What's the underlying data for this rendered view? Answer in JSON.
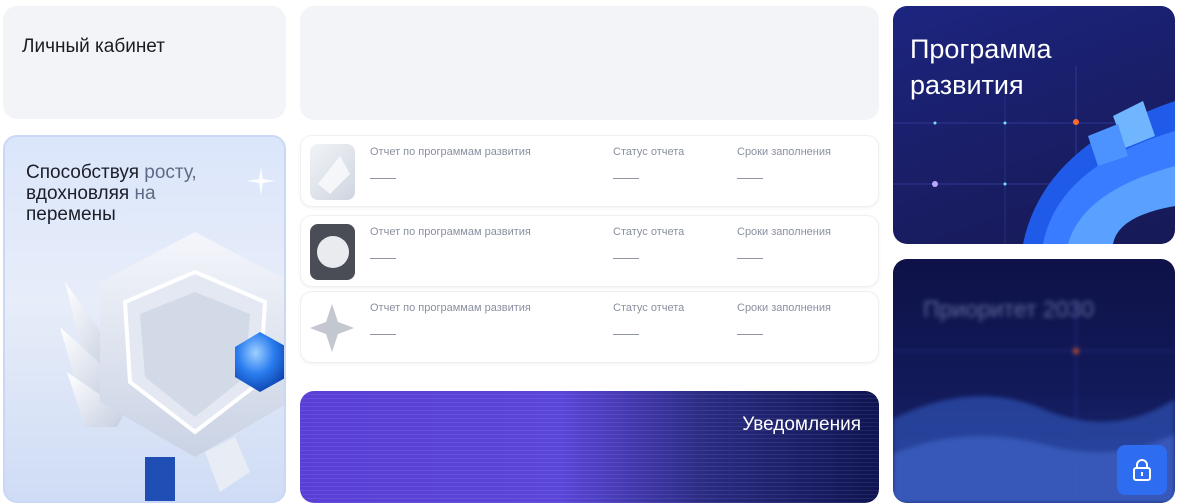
{
  "cabinet": {
    "title": "Личный кабинет"
  },
  "promo": {
    "slogan_part1": "Способствуя",
    "slogan_part2": " росту,",
    "slogan_part3": "вдохновляя",
    "slogan_part4": " на",
    "slogan_part5": "перемены"
  },
  "reports": [
    {
      "name_label": "Отчет по программам развития",
      "status_label": "Статус отчета",
      "deadline_label": "Сроки заполнения"
    },
    {
      "name_label": "Отчет по программам развития",
      "status_label": "Статус отчета",
      "deadline_label": "Сроки заполнения"
    },
    {
      "name_label": "Отчет по программам развития",
      "status_label": "Статус отчета",
      "deadline_label": "Сроки заполнения"
    }
  ],
  "notifications": {
    "label": "Уведомления"
  },
  "dev_program": {
    "title": "Программа развития"
  },
  "priority": {
    "title": "Приоритет 2030",
    "locked": true,
    "icon": "lock-icon"
  },
  "colors": {
    "accent_blue": "#2e6cf0",
    "notification_purple": "#5a3fd6",
    "dark_navy": "#161a55"
  }
}
